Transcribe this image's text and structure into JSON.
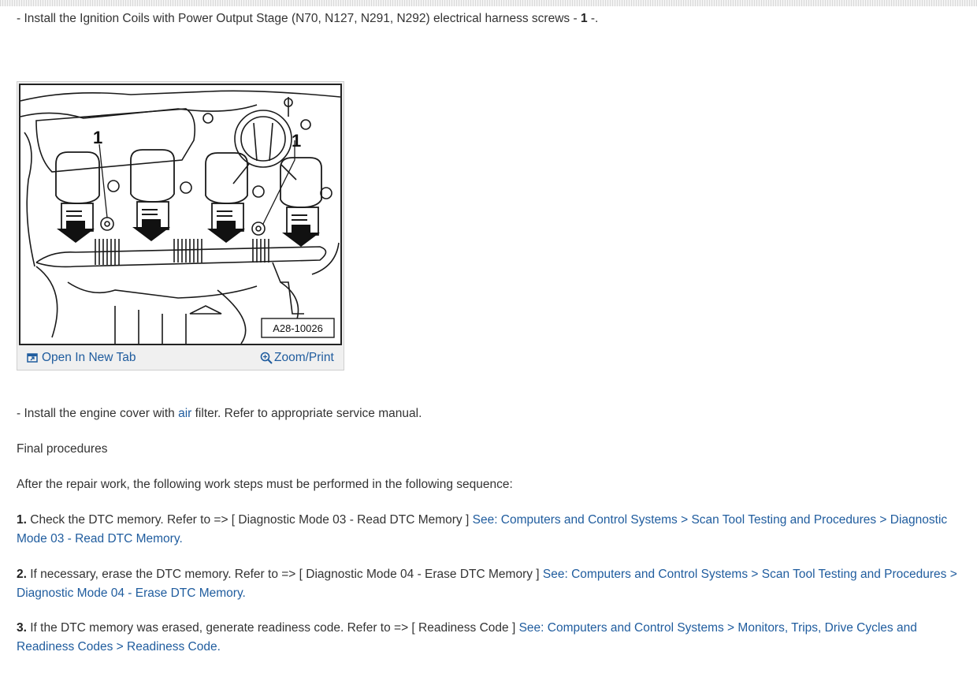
{
  "step_install_coils": {
    "dash": "-",
    "text": "Install the Ignition Coils with Power Output Stage (N70, N127, N291, N292) electrical harness screws -",
    "ref": "1",
    "end": "-."
  },
  "figure": {
    "callout_left": "1",
    "callout_right": "1",
    "image_code": "A28-10026",
    "open_tab_label": "Open In New Tab",
    "zoom_label": "Zoom/Print",
    "icons": [
      "open-new-tab-icon",
      "magnifier-icon"
    ]
  },
  "step_engine_cover": {
    "dash": "-",
    "text_before": "Install the engine cover with",
    "link": "air",
    "text_after": "filter. Refer to appropriate service manual."
  },
  "final_heading": "Final procedures",
  "intro": "After the repair work, the following work steps must be performed in the following sequence:",
  "steps": [
    {
      "num": "1.",
      "text": "Check the DTC memory. Refer to => [ Diagnostic Mode 03 - Read DTC Memory ]",
      "link": "See: Computers and Control Systems > Scan Tool Testing and Procedures > Diagnostic Mode 03 - Read DTC Memory."
    },
    {
      "num": "2.",
      "text": "If necessary, erase the DTC memory. Refer to => [ Diagnostic Mode 04 - Erase DTC Memory ]",
      "link": "See: Computers and Control Systems > Scan Tool Testing and Procedures > Diagnostic Mode 04 - Erase DTC Memory."
    },
    {
      "num": "3.",
      "text": "If the DTC memory was erased, generate readiness code. Refer to => [ Readiness Code ]",
      "link": "See: Computers and Control Systems > Monitors, Trips, Drive Cycles and Readiness Codes > Readiness Code."
    }
  ],
  "colors": {
    "link": "#1f5c9e",
    "text": "#333333"
  }
}
